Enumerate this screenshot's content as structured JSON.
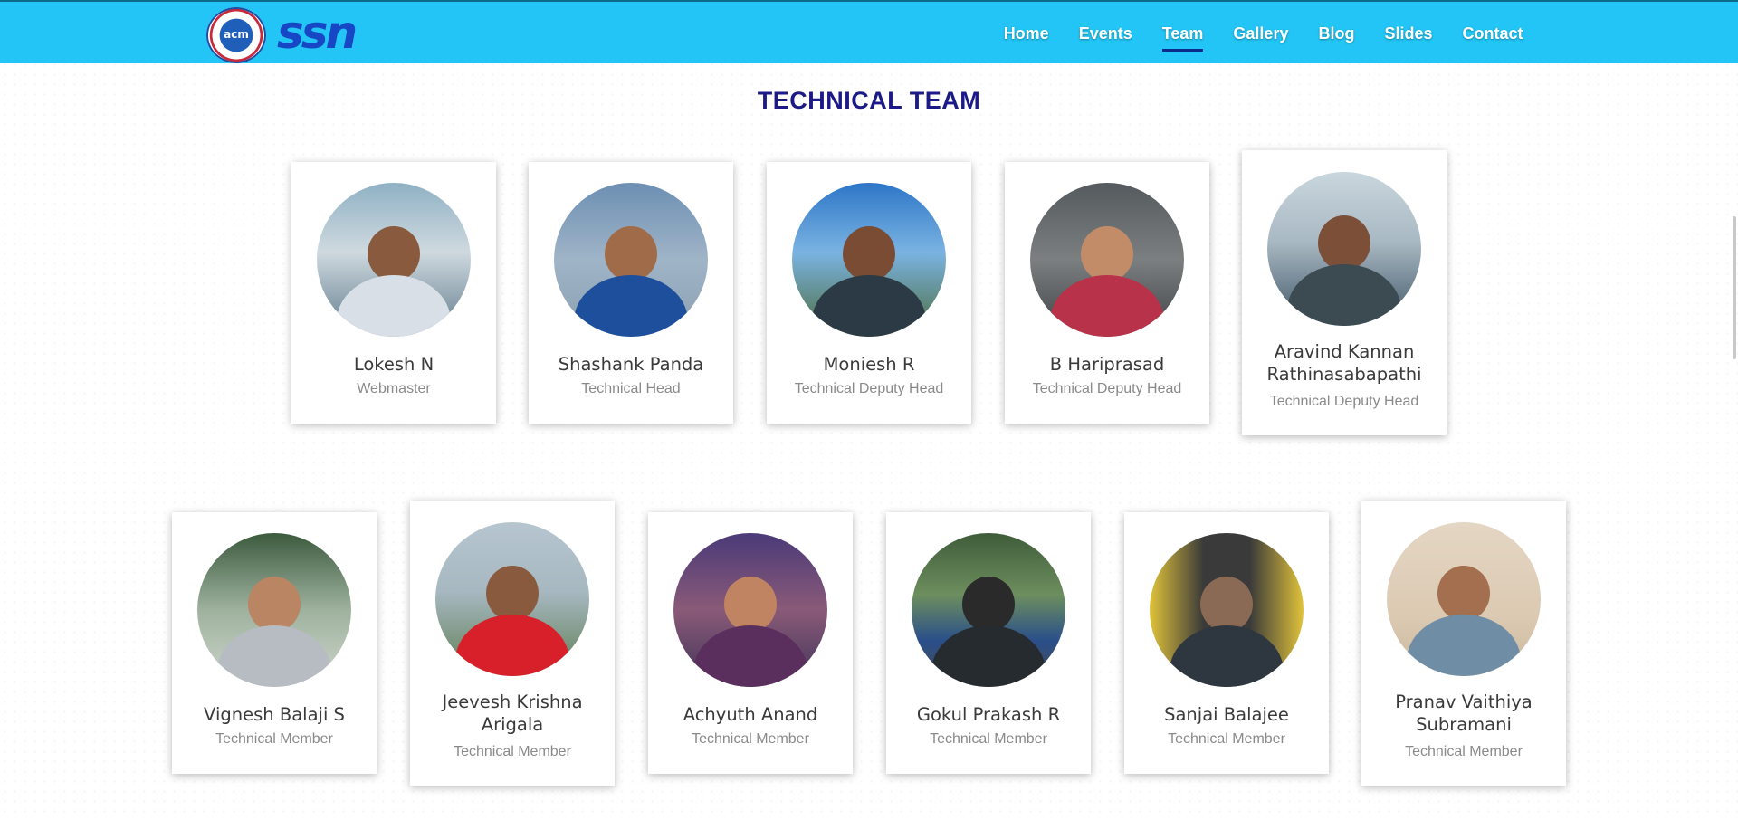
{
  "nav": {
    "logo_seal_text": "acm",
    "logo_text": "ssn",
    "links": [
      "Home",
      "Events",
      "Team",
      "Gallery",
      "Blog",
      "Slides",
      "Contact"
    ],
    "active": "Team",
    "bg_color": "#22c5f5"
  },
  "section": {
    "title": "TECHNICAL TEAM"
  },
  "members": [
    {
      "name": "Lokesh N",
      "role": "Webmaster"
    },
    {
      "name": "Shashank Panda",
      "role": "Technical Head"
    },
    {
      "name": "Moniesh R",
      "role": "Technical Deputy Head"
    },
    {
      "name": "B Hariprasad",
      "role": "Technical Deputy Head"
    },
    {
      "name": "Aravind Kannan Rathinasabapathi",
      "role": "Technical Deputy Head"
    },
    {
      "name": "Vignesh Balaji S",
      "role": "Technical Member"
    },
    {
      "name": "Jeevesh Krishna Arigala",
      "role": "Technical Member"
    },
    {
      "name": "Achyuth Anand",
      "role": "Technical Member"
    },
    {
      "name": "Gokul Prakash R",
      "role": "Technical Member"
    },
    {
      "name": "Sanjai Balajee",
      "role": "Technical Member"
    },
    {
      "name": "Pranav Vaithiya Subramani",
      "role": "Technical Member"
    }
  ]
}
